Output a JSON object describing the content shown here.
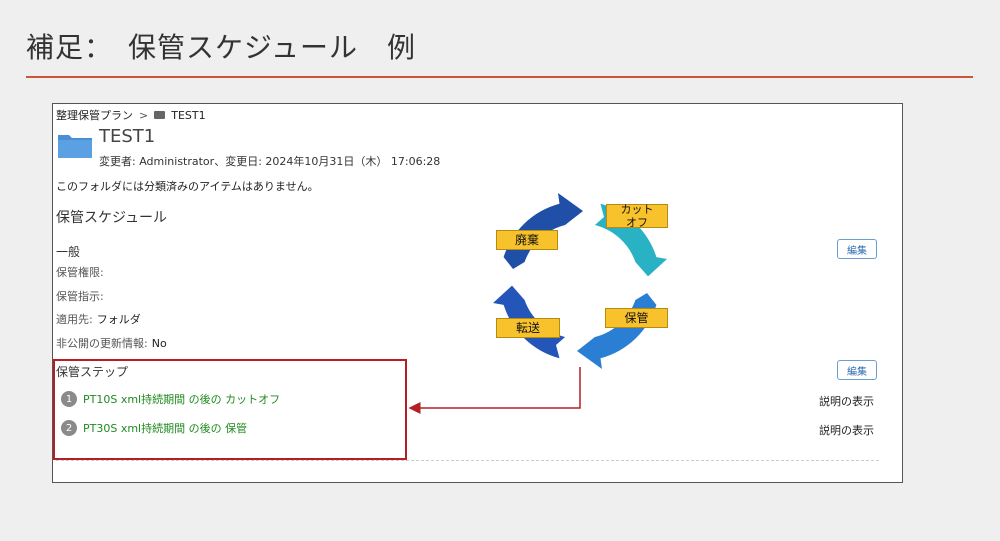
{
  "slide": {
    "title": "補足：　保管スケジュール　例",
    "accent": "#c9553a"
  },
  "breadcrumb": {
    "root": "整理保管プラン",
    "separator": ">",
    "current": "TEST1"
  },
  "object": {
    "title": "TEST1",
    "meta": "変更者: Administrator、変更日: 2024年10月31日（木） 17:06:28",
    "note": "このフォルダには分類済みのアイテムはありません。"
  },
  "schedule": {
    "heading": "保管スケジュール",
    "general": "一般",
    "props": [
      {
        "label": "保管権限:",
        "value": ""
      },
      {
        "label": "保管指示:",
        "value": ""
      },
      {
        "label": "適用先:",
        "value": "フォルダ"
      },
      {
        "label": "非公開の更新情報:",
        "value": "No"
      }
    ],
    "edit_label": "編集"
  },
  "steps": {
    "heading": "保管ステップ",
    "edit_label": "編集",
    "items": [
      {
        "num": "1",
        "text": "PT10S xml持続期間 の後の カットオフ",
        "desc": "説明の表示"
      },
      {
        "num": "2",
        "text": "PT30S xml持続期間 の後の 保管",
        "desc": "説明の表示"
      }
    ]
  },
  "cycle": {
    "labels": {
      "cutoff": "カット\nオフ",
      "store": "保管",
      "transfer": "転送",
      "dispose": "廃棄"
    },
    "colors": {
      "teal": "#29b1c4",
      "blue": "#2a7fd4",
      "navy": "#1f4fa6",
      "label_bg": "#f7c22c",
      "arrow": "#b31f24"
    }
  }
}
